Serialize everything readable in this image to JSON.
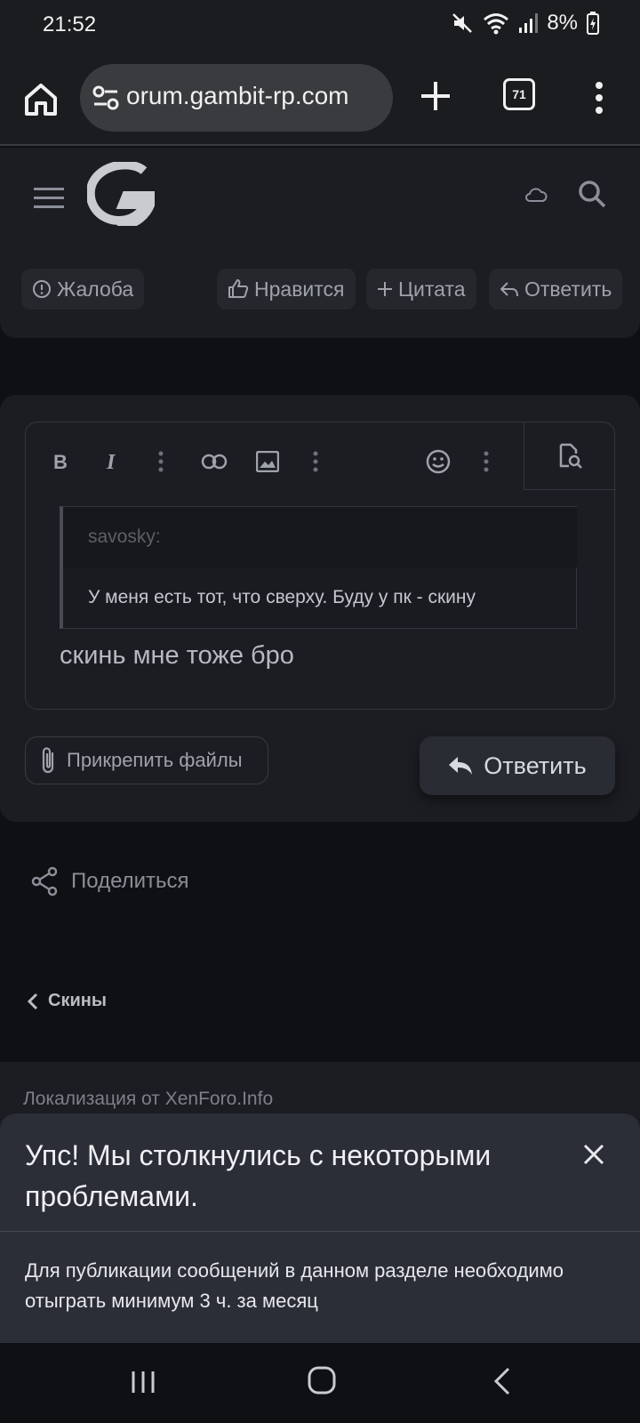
{
  "status_bar": {
    "time": "21:52",
    "battery": "8%"
  },
  "browser": {
    "url": "orum.gambit-rp.com",
    "tab_count": "71"
  },
  "post_actions": {
    "complaint": "Жалоба",
    "like": "Нравится",
    "quote": "Цитата",
    "reply": "Ответить"
  },
  "editor": {
    "quote_author": "savosky:",
    "quote_text": "У меня есть тот, что сверху. Буду у пк - скину",
    "content": "скинь мне тоже бро"
  },
  "reply_form": {
    "attach_label": "Прикрепить файлы",
    "submit_label": "Ответить"
  },
  "share_label": "Поделиться",
  "breadcrumb": "Скины",
  "footer": {
    "localization": "Локализация от XenForo.Info"
  },
  "error_toast": {
    "title": "Упс! Мы столкнулись с некоторыми проблемами.",
    "message": "Для публикации сообщений в данном разделе необходимо отыграть минимум 3 ч. за месяц"
  }
}
